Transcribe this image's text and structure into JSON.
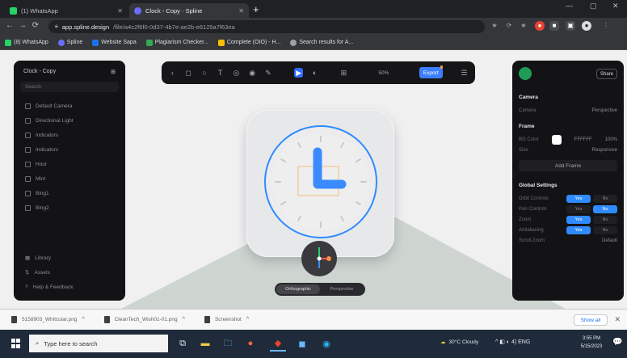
{
  "browser": {
    "tabs": [
      {
        "title": "(1) WhatsApp",
        "favicon_color": "#25d366",
        "active": false
      },
      {
        "title": "Clock - Copy · Spline",
        "favicon_color": "#6b6ef9",
        "active": true
      }
    ],
    "new_tab": "+",
    "window_controls": [
      "—",
      "▢",
      "✕"
    ],
    "url_host": "app.spline.design",
    "url_path": "/file/a4c2f6f0-0d37-4b7e-ae2b-e6125a7f63ea",
    "extensions": [
      "★",
      "⟳",
      "★",
      "⋮"
    ],
    "bookmarks": [
      {
        "label": "(8) WhatsApp",
        "color": "#25d366"
      },
      {
        "label": "Spline",
        "color": "#6b6ef9"
      },
      {
        "label": "Website Sapa",
        "color": "#1a73e8"
      },
      {
        "label": "Plagiarism Checker...",
        "color": "#34a853"
      },
      {
        "label": "Complete (OIO) - H...",
        "color": "#fbbc04"
      },
      {
        "label": "Search results for A...",
        "color": "#9aa0a6"
      }
    ]
  },
  "left_panel": {
    "title": "Clock - Copy",
    "search_placeholder": "Search",
    "items": [
      {
        "label": "Default Camera"
      },
      {
        "label": "Directional Light"
      },
      {
        "label": "Indicators"
      },
      {
        "label": "Indicators"
      },
      {
        "label": "Hour"
      },
      {
        "label": "Mint"
      },
      {
        "label": "Bing1"
      },
      {
        "label": "Bing2"
      }
    ],
    "bottom_items": [
      {
        "label": "Library"
      },
      {
        "label": "Assets"
      },
      {
        "label": "Help & Feedback"
      }
    ]
  },
  "top_toolbar": {
    "tools": [
      "‹",
      "◻",
      "○",
      "T",
      "◎",
      "◉",
      "✎",
      "▶",
      "◐",
      "⊞"
    ],
    "selected_index": 7,
    "zoom": "50%",
    "export_label": "Export",
    "share_icon": "☰"
  },
  "right_panel": {
    "share_label": "Share",
    "camera_section": "Camera",
    "camera_row": {
      "label": "Camera",
      "value": "Perspective"
    },
    "frame_section": "Frame",
    "frame_rows": [
      {
        "label": "BG Color",
        "value": "FFFFFF",
        "extra": "100%"
      },
      {
        "label": "Size",
        "value": "Responsive"
      }
    ],
    "add_frame_label": "Add Frame",
    "global_section": "Global Settings",
    "settings": [
      {
        "label": "Orbit Controls",
        "options": [
          "Yes",
          "No"
        ],
        "on": 0
      },
      {
        "label": "Pan Controls",
        "options": [
          "Yes",
          "No"
        ],
        "on": 1
      },
      {
        "label": "Zoom",
        "options": [
          "Yes",
          "No"
        ],
        "on": 0
      },
      {
        "label": "Antialiasing",
        "options": [
          "Yes",
          "No"
        ],
        "on": 0
      }
    ],
    "scroll_row": {
      "label": "Scroll Zoom",
      "value": "Default"
    }
  },
  "canvas": {
    "view_options": [
      "Orthographic",
      "Perspective"
    ],
    "view_selected": 0,
    "clock_accent": "#2f8bff",
    "hand_color": "#3a8bff",
    "tile_color": "#e7e8ea"
  },
  "downloads": {
    "items": [
      {
        "name": "5158903_Whitcular.png"
      },
      {
        "name": "CleanTech_Wish01-01.png"
      },
      {
        "name": "Screenshot"
      }
    ],
    "show_all_label": "Show all",
    "close": "✕"
  },
  "taskbar": {
    "search_placeholder": "Type here to search",
    "apps": [
      "⧉",
      "▬",
      "🗀",
      "●",
      "◆",
      "◼",
      "◉"
    ],
    "active_app_index": 4,
    "weather": "30°C Cloudy",
    "tray": "^ ◧ ◐ 4) ENG",
    "time": "3:55 PM",
    "date": "5/15/2023",
    "notification": "💬"
  }
}
